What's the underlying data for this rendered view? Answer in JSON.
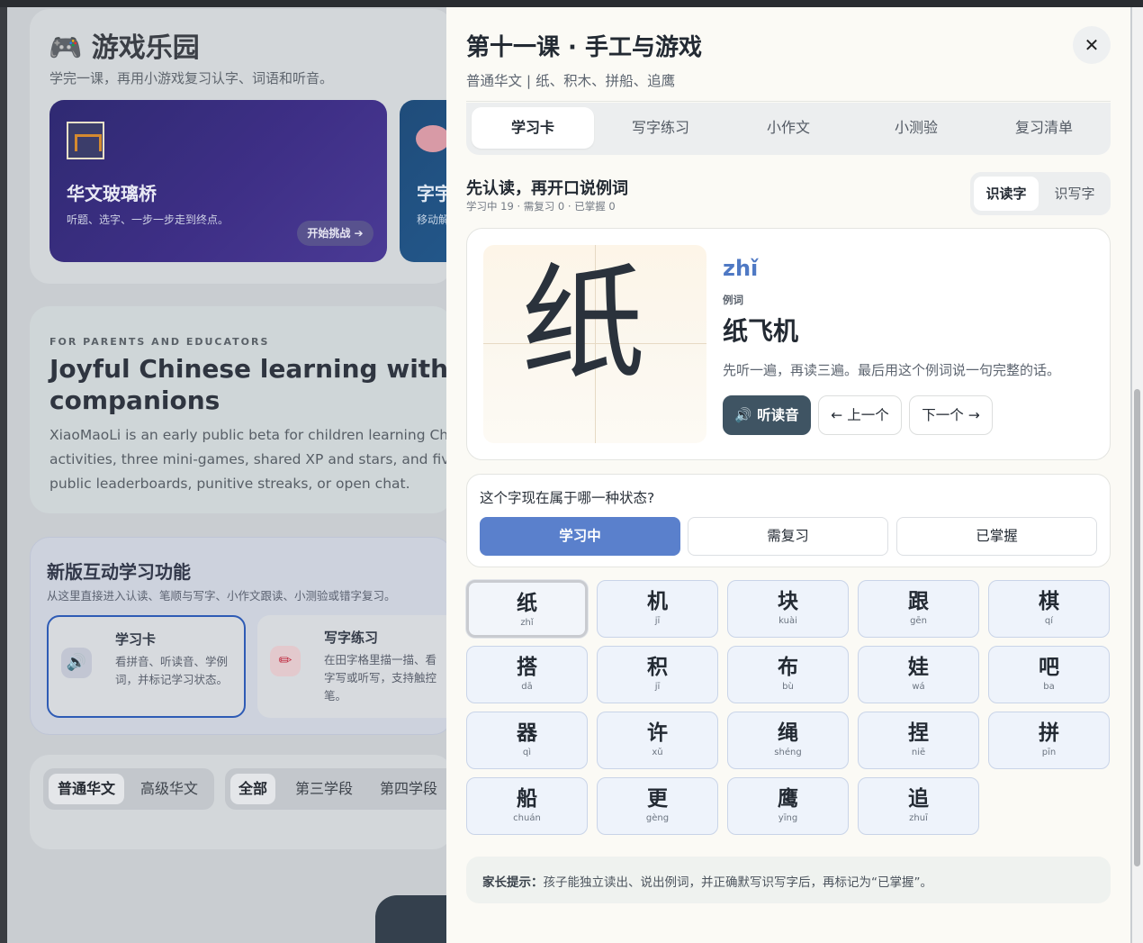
{
  "background": {
    "games": {
      "title": "🎮 游戏乐园",
      "subtitle": "学完一课，再用小游戏复习认字、词语和听音。",
      "card1": {
        "title": "华文玻璃桥",
        "desc": "听题、选字、一步一步走到终点。",
        "button": "开始挑战 ➔"
      },
      "card2": {
        "title": "字宇",
        "desc": "移动解"
      }
    },
    "parents": {
      "eyebrow": "FOR PARENTS AND EDUCATORS",
      "title_line1": "Joyful Chinese learning with gr",
      "title_line2": "companions",
      "body_line1": "XiaoMaoLi is an early public beta for children learning Chines",
      "body_line2": "activities, three mini-games, shared XP and stars, and five un",
      "body_line3": "public leaderboards, punitive streaks, or open chat."
    },
    "features": {
      "title": "新版互动学习功能",
      "subtitle": "从这里直接进入认读、笔顺与写字、小作文跟读、小测验或错字复习。",
      "card1": {
        "icon": "🔊",
        "title": "学习卡",
        "desc": "看拼音、听读音、学例词，并标记学习状态。"
      },
      "card2": {
        "icon": "✏",
        "title": "写字练习",
        "desc": "在田字格里描一描、看字写或听写，支持触控笔。"
      }
    },
    "filters": {
      "group1": [
        "普通华文",
        "高级华文"
      ],
      "group2": [
        "全部",
        "第三学段",
        "第四学段"
      ]
    }
  },
  "drawer": {
    "title": "第十一课 · 手工与游戏",
    "subtitle": "普通华文 | 纸、积木、拼船、追鹰",
    "close_icon": "✕",
    "tabs": [
      "学习卡",
      "写字练习",
      "小作文",
      "小测验",
      "复习清单"
    ],
    "section_title": "先认读，再开口说例词",
    "section_meta": "学习中 19 · 需复习 0 · 已掌握 0",
    "modes": [
      "识读字",
      "识写字"
    ],
    "card": {
      "hanzi": "纸",
      "pinyin": "zhǐ",
      "example_label": "例词",
      "example_word": "纸飞机",
      "instruction": "先听一遍，再读三遍。最后用这个例词说一句完整的话。",
      "listen_button": "🔊 听读音",
      "prev_button": "← 上一个",
      "next_button": "下一个 →"
    },
    "status": {
      "question": "这个字现在属于哪一种状态?",
      "options": [
        "学习中",
        "需复习",
        "已掌握"
      ]
    },
    "characters": [
      {
        "h": "纸",
        "p": "zhǐ"
      },
      {
        "h": "机",
        "p": "jī"
      },
      {
        "h": "块",
        "p": "kuài"
      },
      {
        "h": "跟",
        "p": "gēn"
      },
      {
        "h": "棋",
        "p": "qí"
      },
      {
        "h": "搭",
        "p": "dā"
      },
      {
        "h": "积",
        "p": "jī"
      },
      {
        "h": "布",
        "p": "bù"
      },
      {
        "h": "娃",
        "p": "wá"
      },
      {
        "h": "吧",
        "p": "ba"
      },
      {
        "h": "器",
        "p": "qì"
      },
      {
        "h": "许",
        "p": "xǔ"
      },
      {
        "h": "绳",
        "p": "shéng"
      },
      {
        "h": "捏",
        "p": "niē"
      },
      {
        "h": "拼",
        "p": "pīn"
      },
      {
        "h": "船",
        "p": "chuán"
      },
      {
        "h": "更",
        "p": "gèng"
      },
      {
        "h": "鹰",
        "p": "yīng"
      },
      {
        "h": "追",
        "p": "zhuī"
      }
    ],
    "tip_label": "家长提示：",
    "tip_text": "孩子能独立读出、说出例词，并正确默写识写字后，再标记为“已掌握”。"
  }
}
